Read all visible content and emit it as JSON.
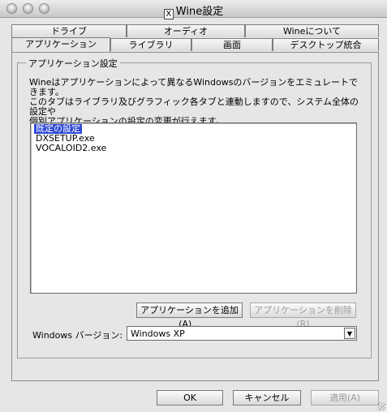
{
  "window": {
    "title": "Wine設定"
  },
  "tabs_row1": [
    {
      "label": "ドライブ"
    },
    {
      "label": "オーディオ"
    },
    {
      "label": "Wineについて"
    }
  ],
  "tabs_row2": [
    {
      "label": "アプリケーション",
      "active": true
    },
    {
      "label": "ライブラリ"
    },
    {
      "label": "画面"
    },
    {
      "label": "デスクトップ統合"
    }
  ],
  "app_settings": {
    "group_label": "アプリケーション設定",
    "description": [
      "Wineはアプリケーションによって異なるWindowsのバージョンをエミュレートできます。",
      "このタブはライブラリ及びグラフィック各タブと連動しますので、システム全体の設定や",
      "個別アプリケーションの設定の変更が行えます。"
    ],
    "apps": [
      {
        "label": "既定の設定",
        "selected": true
      },
      {
        "label": "DXSETUP.exe"
      },
      {
        "label": "VOCALOID2.exe"
      }
    ],
    "add_button": "アプリケーションを追加(A)...",
    "remove_button": "アプリケーションを削除(R)",
    "version_label": "Windows バージョン:",
    "version_value": "Windows XP"
  },
  "footer": {
    "ok": "OK",
    "cancel": "キャンセル",
    "apply": "適用(A)"
  }
}
